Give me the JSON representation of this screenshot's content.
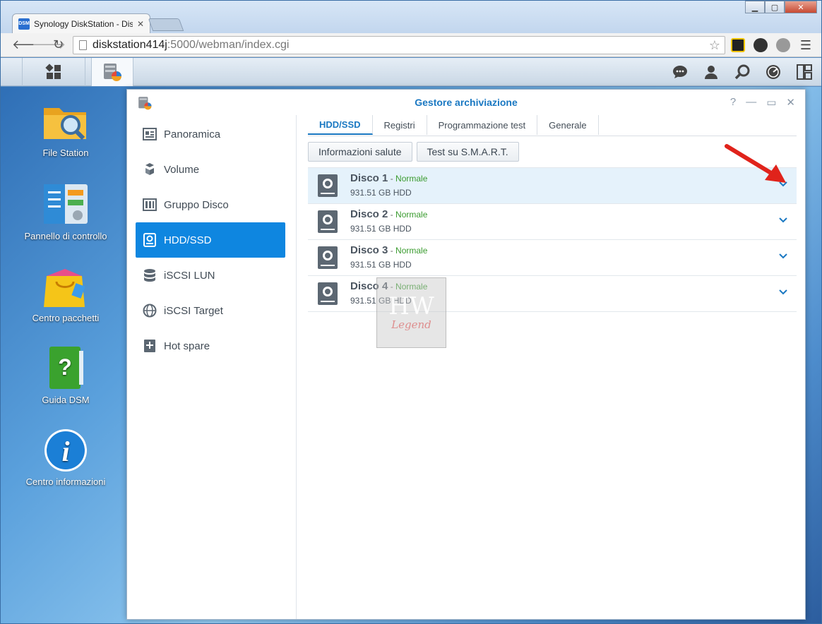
{
  "browser": {
    "tab_title": "Synology DiskStation - Dis",
    "tab_favicon": "DSM",
    "url_host": "diskstation414j",
    "url_rest": ":5000/webman/index.cgi",
    "win_min": "▁",
    "win_max": "▢",
    "win_close": "✕"
  },
  "dsm_bar": {
    "main_menu_icon": "grid-icon",
    "app_icon": "storage-manager-icon",
    "tray": [
      "chat-icon",
      "user-icon",
      "search-icon",
      "dashboard-icon",
      "widgets-icon"
    ]
  },
  "desktop": {
    "items": [
      {
        "label": "File Station",
        "icon": "folder-search-icon"
      },
      {
        "label": "Pannello di controllo",
        "icon": "control-panel-icon"
      },
      {
        "label": "Centro pacchetti",
        "icon": "package-bag-icon"
      },
      {
        "label": "Guida DSM",
        "icon": "help-book-icon"
      },
      {
        "label": "Centro informazioni",
        "icon": "info-icon"
      }
    ]
  },
  "window": {
    "title": "Gestore archiviazione",
    "ctrl_help": "?",
    "ctrl_min": "—",
    "ctrl_max": "▭",
    "ctrl_close": "✕",
    "sidebar": [
      {
        "label": "Panoramica",
        "icon": "overview-icon"
      },
      {
        "label": "Volume",
        "icon": "volume-icon"
      },
      {
        "label": "Gruppo Disco",
        "icon": "disk-group-icon"
      },
      {
        "label": "HDD/SSD",
        "icon": "hdd-icon",
        "active": true
      },
      {
        "label": "iSCSI LUN",
        "icon": "database-icon"
      },
      {
        "label": "iSCSI Target",
        "icon": "globe-icon"
      },
      {
        "label": "Hot spare",
        "icon": "plus-box-icon"
      }
    ],
    "tabs": [
      "HDD/SSD",
      "Registri",
      "Programmazione test",
      "Generale"
    ],
    "buttons": [
      "Informazioni salute",
      "Test su S.M.A.R.T."
    ],
    "disks": [
      {
        "name": "Disco 1",
        "sep": " - ",
        "status": "Normale",
        "info": "931.51 GB HDD",
        "selected": true
      },
      {
        "name": "Disco 2",
        "sep": " - ",
        "status": "Normale",
        "info": "931.51 GB HDD"
      },
      {
        "name": "Disco 3",
        "sep": " - ",
        "status": "Normale",
        "info": "931.51 GB HDD"
      },
      {
        "name": "Disco 4",
        "sep": " - ",
        "status": "Normale",
        "info": "931.51 GB HDD"
      }
    ]
  },
  "watermark": {
    "big": "HW",
    "small": "Legend"
  },
  "colors": {
    "accent": "#0e86e0",
    "status_ok": "#3a9b2f",
    "arrow": "#e0231b"
  }
}
